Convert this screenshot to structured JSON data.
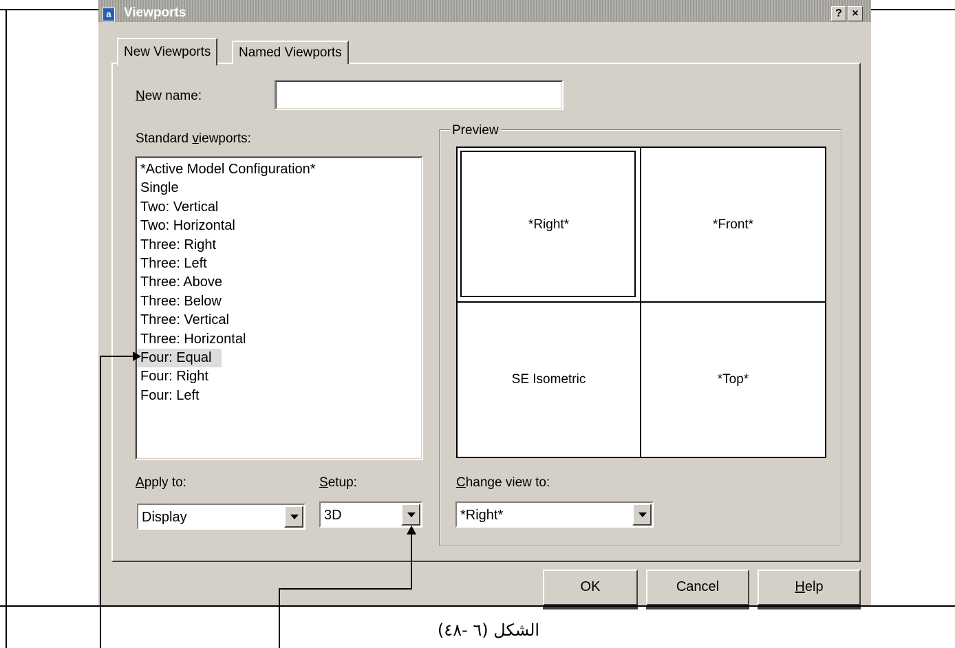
{
  "dialog": {
    "title": "Viewports",
    "help_glyph": "?",
    "close_glyph": "×"
  },
  "tabs": [
    {
      "label": "New Viewports",
      "active": true
    },
    {
      "label": "Named Viewports",
      "active": false
    }
  ],
  "new_name": {
    "label_accel": "N",
    "label_rest": "ew name:",
    "value": ""
  },
  "standard_viewports": {
    "label_pre": "Standard ",
    "label_accel": "v",
    "label_post": "iewports:",
    "items": [
      "*Active Model Configuration*",
      "Single",
      "Two:  Vertical",
      "Two:  Horizontal",
      "Three: Right",
      "Three: Left",
      "Three: Above",
      "Three: Below",
      "Three: Vertical",
      "Three: Horizontal",
      "Four:  Equal",
      "Four:  Right",
      "Four:  Left"
    ],
    "selected_index": 10
  },
  "preview": {
    "label": "Preview",
    "cells": [
      "*Right*",
      "*Front*",
      "SE Isometric",
      "*Top*"
    ]
  },
  "apply_to": {
    "label_accel": "A",
    "label_rest": "pply to:",
    "value": "Display"
  },
  "setup": {
    "label_accel": "S",
    "label_rest": "etup:",
    "value": "3D"
  },
  "change_view": {
    "label_accel": "C",
    "label_rest": "hange view to:",
    "value": "*Right*"
  },
  "buttons": {
    "ok": "OK",
    "cancel": "Cancel",
    "help_accel": "H",
    "help_rest": "elp"
  },
  "caption": "الشكل (٦ -٤٨)",
  "colors": {
    "dialog_face": "#d4d0c8",
    "highlight": "#ffffff",
    "shadow": "#404040",
    "selection": "#dcdcdc"
  }
}
